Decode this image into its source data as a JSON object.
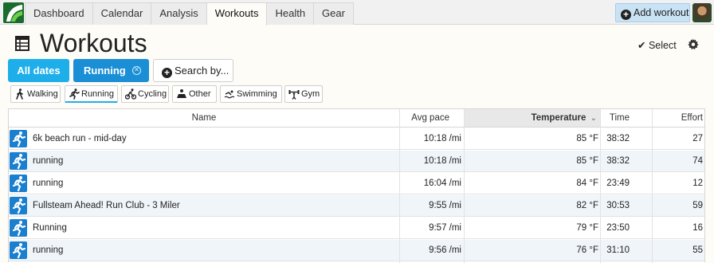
{
  "nav": {
    "tabs": [
      {
        "label": "Dashboard",
        "active": false
      },
      {
        "label": "Calendar",
        "active": false
      },
      {
        "label": "Analysis",
        "active": false
      },
      {
        "label": "Workouts",
        "active": true
      },
      {
        "label": "Health",
        "active": false
      },
      {
        "label": "Gear",
        "active": false
      }
    ],
    "add_workout_label": "Add workout"
  },
  "page": {
    "title": "Workouts",
    "select_label": "Select"
  },
  "filters": {
    "all_dates_label": "All dates",
    "running_label": "Running",
    "search_label": "Search by..."
  },
  "activity_types": [
    {
      "label": "Walking",
      "icon": "walking-icon",
      "active": false
    },
    {
      "label": "Running",
      "icon": "running-icon",
      "active": true
    },
    {
      "label": "Cycling",
      "icon": "cycling-icon",
      "active": false
    },
    {
      "label": "Other",
      "icon": "other-icon",
      "active": false
    },
    {
      "label": "Swimming",
      "icon": "swimming-icon",
      "active": false
    },
    {
      "label": "Gym",
      "icon": "gym-icon",
      "active": false
    }
  ],
  "table": {
    "columns": {
      "name": "Name",
      "avg_pace": "Avg pace",
      "temperature": "Temperature",
      "time": "Time",
      "effort": "Effort"
    },
    "sorted_column": "temperature",
    "sort_direction": "descending",
    "rows": [
      {
        "name": "6k beach run - mid-day",
        "avg_pace": "10:18 /mi",
        "temperature": "85 °F",
        "time": "38:32",
        "effort": "27"
      },
      {
        "name": "running",
        "avg_pace": "10:18 /mi",
        "temperature": "85 °F",
        "time": "38:32",
        "effort": "74"
      },
      {
        "name": "running",
        "avg_pace": "16:04 /mi",
        "temperature": "84 °F",
        "time": "23:49",
        "effort": "12"
      },
      {
        "name": "Fullsteam Ahead! Run Club - 3 Miler",
        "avg_pace": "9:55 /mi",
        "temperature": "82 °F",
        "time": "30:53",
        "effort": "59"
      },
      {
        "name": "Running",
        "avg_pace": "9:57 /mi",
        "temperature": "79 °F",
        "time": "23:50",
        "effort": "16"
      },
      {
        "name": "running",
        "avg_pace": "9:56 /mi",
        "temperature": "76 °F",
        "time": "31:10",
        "effort": "55"
      }
    ]
  },
  "colors": {
    "accent_light": "#1eaeea",
    "accent_dark": "#1a8fd6",
    "row_alt": "#f0f5fa",
    "run_icon_bg": "#1a7fcf"
  }
}
